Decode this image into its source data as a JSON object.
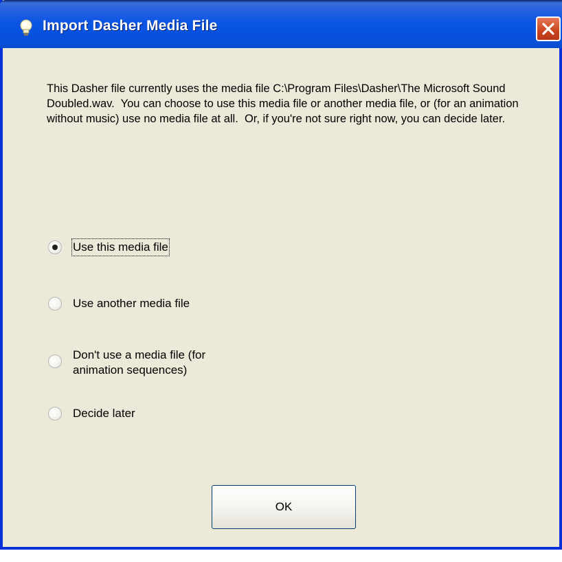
{
  "window": {
    "title": "Import Dasher Media File",
    "colors": {
      "titlebar": "#0752e0",
      "body": "#ece9d8",
      "close": "#c9451f"
    },
    "icons": {
      "title": "lightbulb-icon",
      "close": "close-icon"
    }
  },
  "description": "This Dasher file currently uses the media file C:\\Program Files\\Dasher\\The Microsoft Sound Doubled.wav.  You can choose to use this media file or another media file, or (for an animation without music) use no media file at all.  Or, if you're not sure right now, you can decide later.",
  "options": [
    {
      "label": "Use this media file",
      "checked": true
    },
    {
      "label": "Use another media file",
      "checked": false
    },
    {
      "label": "Don't use a media file (for\nanimation sequences)",
      "checked": false
    },
    {
      "label": "Decide later",
      "checked": false
    }
  ],
  "buttons": {
    "ok": "OK"
  }
}
